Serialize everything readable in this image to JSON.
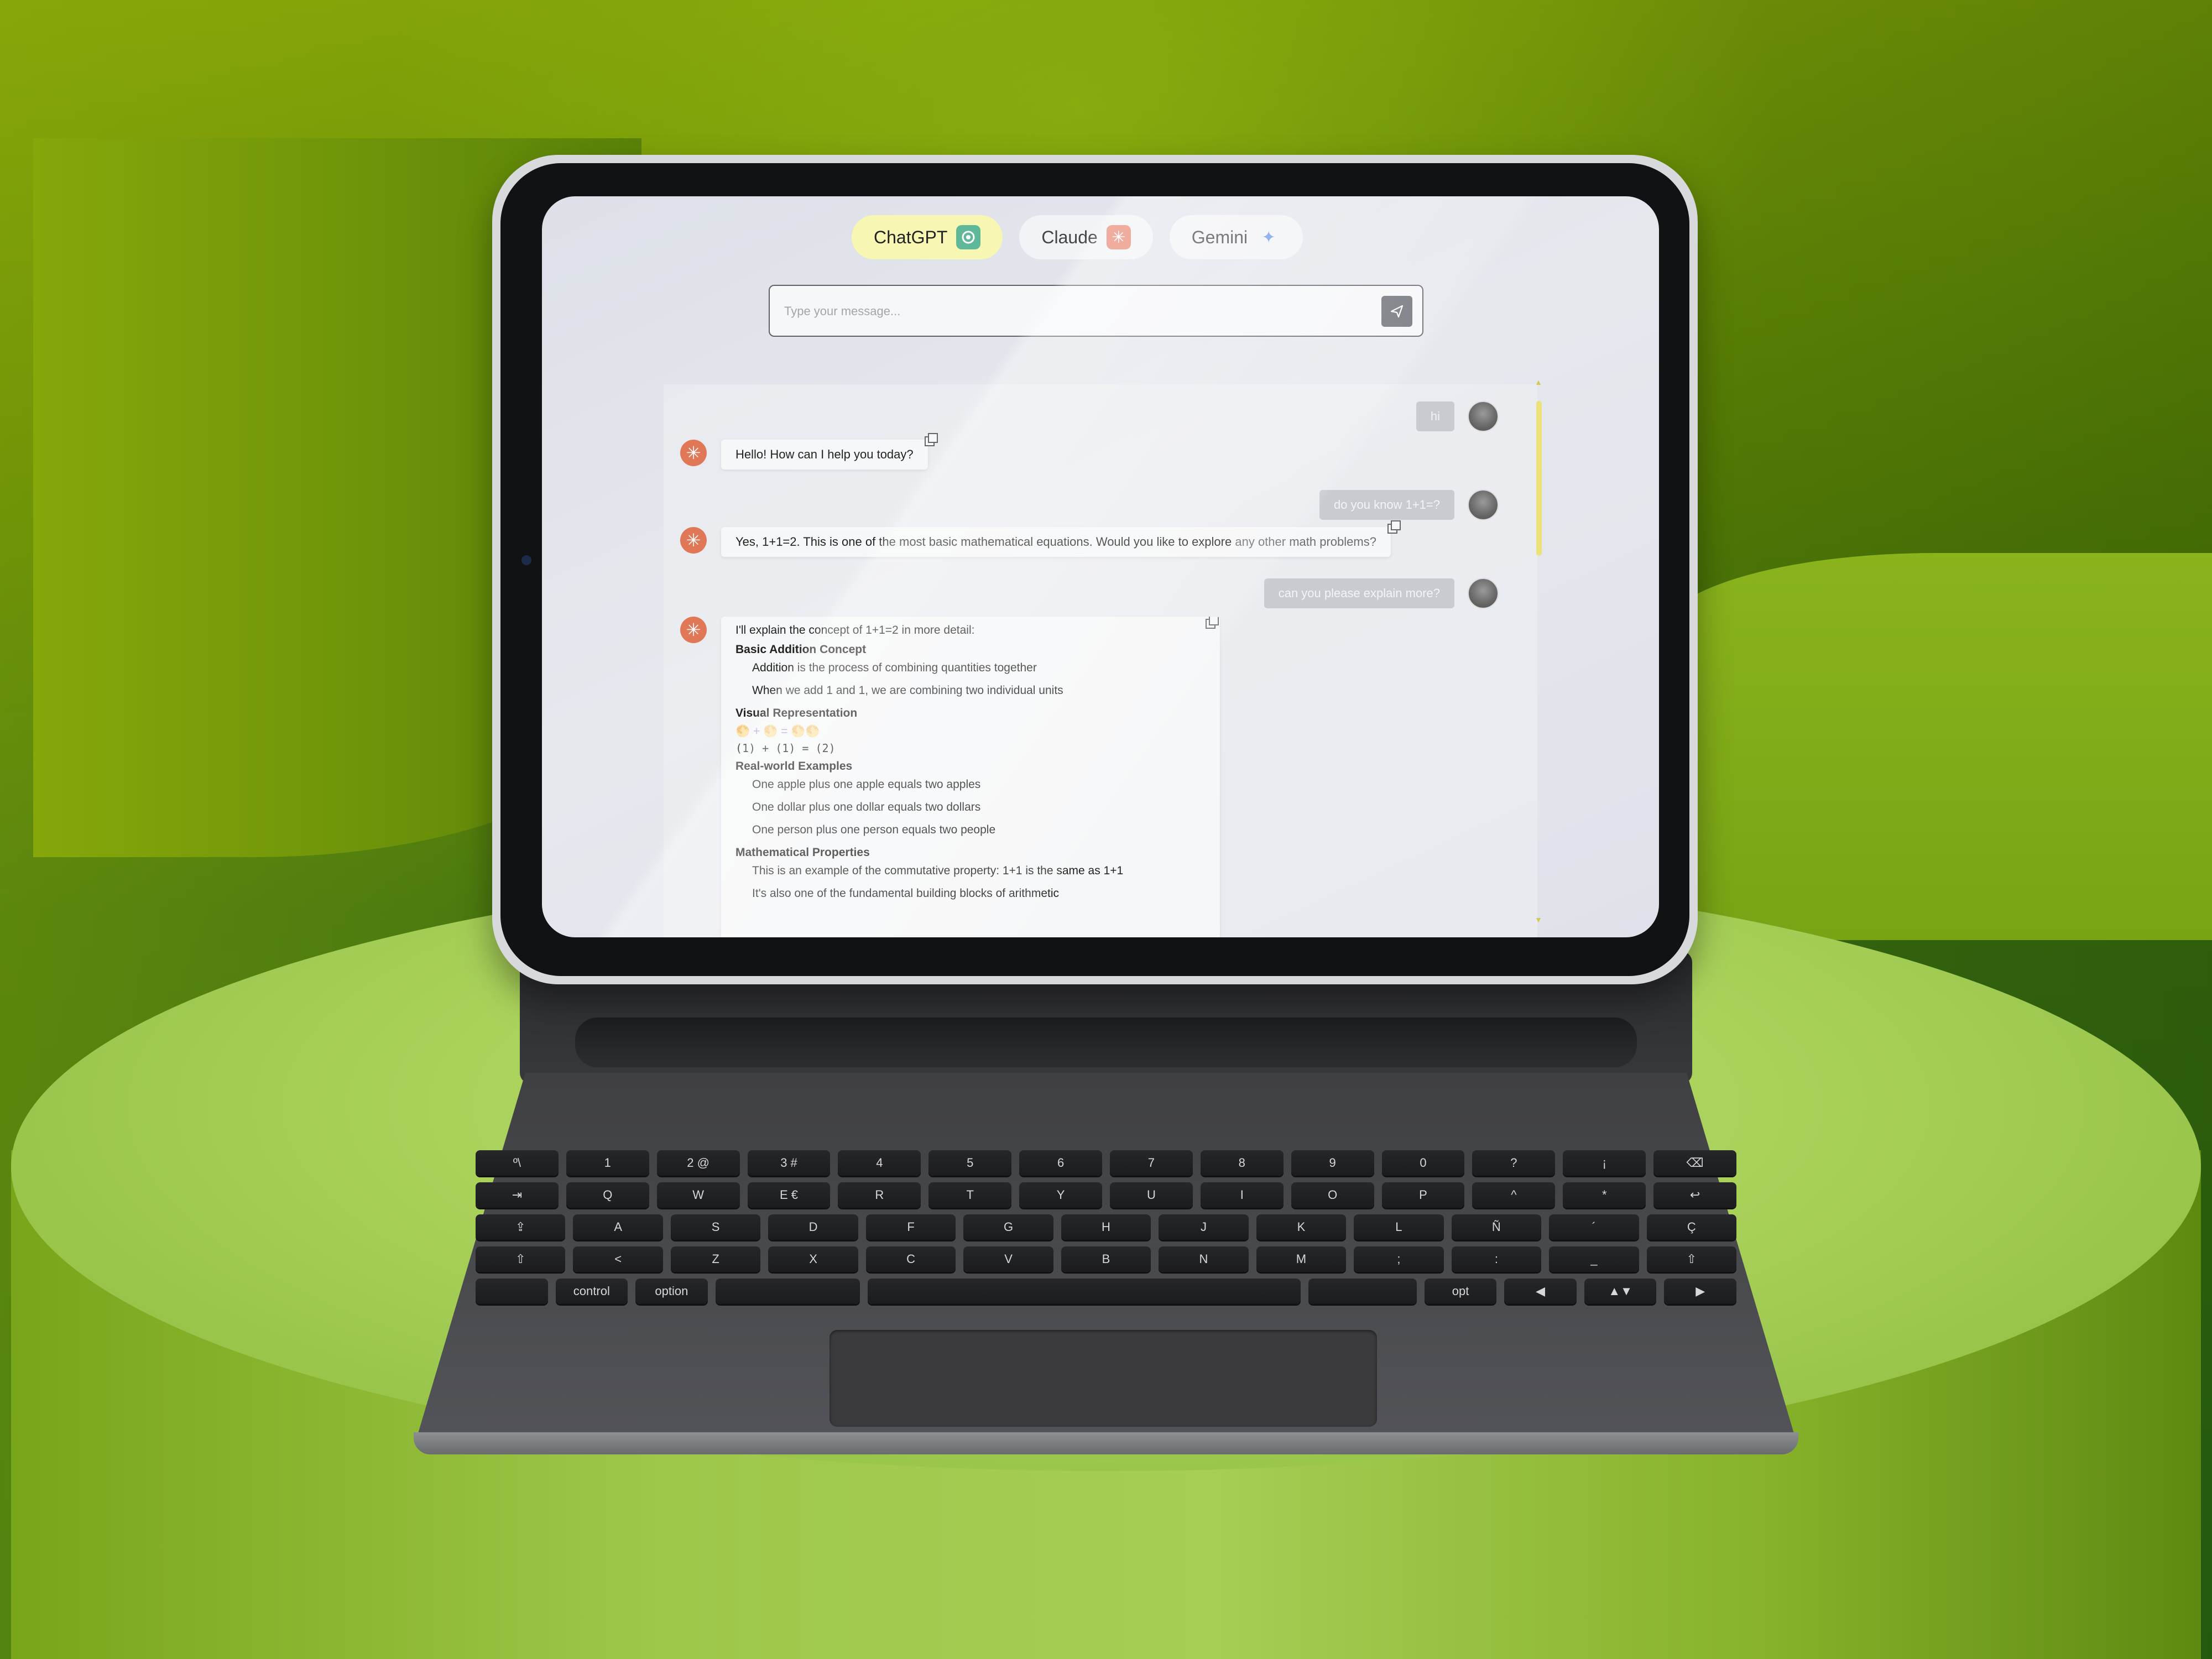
{
  "tabs": [
    {
      "label": "ChatGPT",
      "icon": "chatgpt-logo-icon",
      "active": true
    },
    {
      "label": "Claude",
      "icon": "claude-logo-icon",
      "active": false
    },
    {
      "label": "Gemini",
      "icon": "gemini-sparkle-icon",
      "active": false
    }
  ],
  "input": {
    "placeholder": "Type your message...",
    "value": ""
  },
  "messages": {
    "m1": {
      "text": "hi"
    },
    "m2": {
      "text": "Hello! How can I help you today?"
    },
    "m3": {
      "text": "do you know 1+1=?"
    },
    "m4": {
      "text": "Yes, 1+1=2. This is one of the most basic mathematical equations. Would you like to explore",
      "muted": "any other math problems?"
    },
    "m5": {
      "text": "can you please explain more?"
    },
    "m6": {
      "intro": "I'll explain the concept of 1+1=2 in more detail:",
      "s1_title": "Basic Addition Concept",
      "s1_p1": "Addition is the process of combining quantities together",
      "s1_p2": "When we add 1 and 1, we are combining two individual units",
      "s2_title": "Visual Representation",
      "s2_symbols": "🌕 + 🌕 = 🌕🌕",
      "s2_formula": "(1) + (1) = (2)",
      "s3_title": "Real-world Examples",
      "s3_p1": "One apple plus one apple equals two apples",
      "s3_p2": "One dollar plus one dollar equals two dollars",
      "s3_p3": "One person plus one person equals two people",
      "s4_title": "Mathematical Properties",
      "s4_p1": "This is an example of the commutative property: 1+1 is the same as 1+1",
      "s4_p2": "It's also one of the fundamental building blocks of arithmetic"
    }
  },
  "keyboard": {
    "row1": [
      "º\\",
      "1",
      "2 @",
      "3 #",
      "4",
      "5",
      "6",
      "7",
      "8",
      "9",
      "0",
      "?",
      "¡",
      "⌫"
    ],
    "row2": [
      "⇥",
      "Q",
      "W",
      "E €",
      "R",
      "T",
      "Y",
      "U",
      "I",
      "O",
      "P",
      "^",
      "*",
      "↩"
    ],
    "row3": [
      "⇪",
      "A",
      "S",
      "D",
      "F",
      "G",
      "H",
      "J",
      "K",
      "L",
      "Ñ",
      "´",
      "Ç"
    ],
    "row4": [
      "⇧",
      "<",
      "Z",
      "X",
      "C",
      "V",
      "B",
      "N",
      "M",
      ";",
      ":",
      "_",
      "⇧"
    ],
    "row5": [
      "",
      "control",
      "option",
      "",
      "",
      "",
      "opt",
      "◀",
      "▲▼",
      "▶"
    ]
  },
  "colors": {
    "active_tab": "#f8f6b3",
    "bot_avatar": "#e07858",
    "scrollbar": "#ede27a"
  }
}
